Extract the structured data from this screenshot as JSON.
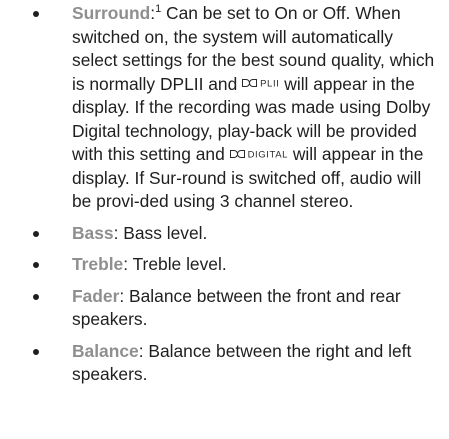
{
  "items": [
    {
      "term": "Surround",
      "colon": ":",
      "footnote": "1",
      "text_1": " Can be set to On or Off. When switched on, the system will automatically select settings for the best sound quality, which is normally DPLII and ",
      "logo_pl": "PLII",
      "text_2": " will appear in the display. If the recording was made using Dolby Digital technology, play-back will be provided with this setting and ",
      "logo_digital": "DIGITAL",
      "text_3": " will appear in the display. If Sur-round is switched off, audio will be provi-ded using 3 channel stereo."
    },
    {
      "term": "Bass",
      "text": ": Bass level."
    },
    {
      "term": "Treble",
      "text": ": Treble level."
    },
    {
      "term": "Fader",
      "text": ": Balance between the front and rear speakers."
    },
    {
      "term": "Balance",
      "text": ": Balance between the right and left speakers."
    }
  ],
  "colors": {
    "term": "#8f8f8f",
    "text": "#1f1f1f"
  },
  "icons": {
    "logo": "dolby-double-d-icon",
    "bullet": "bullet-dot"
  }
}
